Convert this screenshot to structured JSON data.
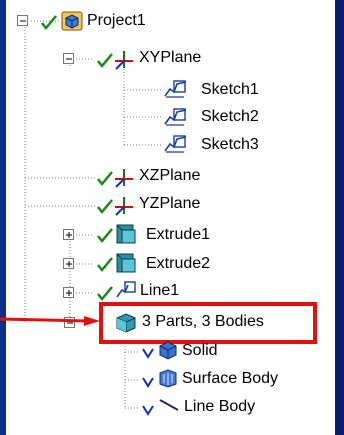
{
  "tree": {
    "project": {
      "label": "Project1",
      "icon": "project-icon"
    },
    "xy_plane": {
      "label": "XYPlane",
      "icon": "plane-axes-icon"
    },
    "sketches": [
      {
        "label": "Sketch1",
        "icon": "sketch-icon"
      },
      {
        "label": "Sketch2",
        "icon": "sketch-icon"
      },
      {
        "label": "Sketch3",
        "icon": "sketch-icon"
      }
    ],
    "xz_plane": {
      "label": "XZPlane",
      "icon": "plane-axes-icon"
    },
    "yz_plane": {
      "label": "YZPlane",
      "icon": "plane-axes-icon"
    },
    "extrude1": {
      "label": "Extrude1",
      "icon": "extrude-icon"
    },
    "extrude2": {
      "label": "Extrude2",
      "icon": "extrude-icon"
    },
    "line1": {
      "label": "Line1",
      "icon": "sketch-icon"
    },
    "parts": {
      "label": "3 Parts, 3 Bodies",
      "icon": "parts-icon"
    },
    "bodies": [
      {
        "label": "Solid",
        "icon": "solid-body-icon"
      },
      {
        "label": "Surface Body",
        "icon": "surface-body-icon"
      },
      {
        "label": "Line Body",
        "icon": "line-body-icon"
      }
    ]
  },
  "colors": {
    "check": "#1a8a1a",
    "highlight": "#e01010",
    "frame": "#0b2f8a",
    "tree_line": "#808080"
  }
}
